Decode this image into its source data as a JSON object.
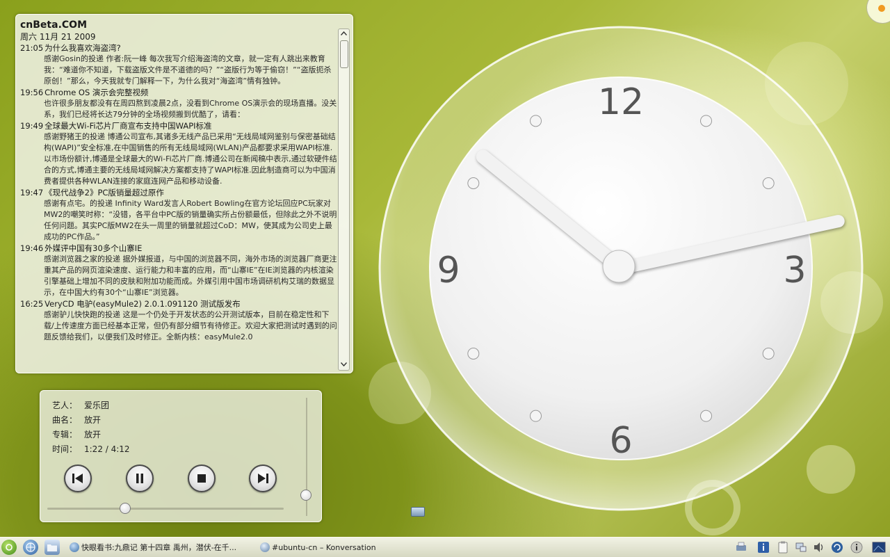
{
  "news_widget": {
    "title": "cnBeta.COM",
    "date": "周六 11月 21 2009",
    "items": [
      {
        "time": "21:05",
        "headline": "为什么我喜欢海盗湾?",
        "body": "感谢Gosin的投递 作者:阮一峰 每次我写介绍海盗湾的文章，就一定有人跳出来教育我：“难道你不知道，下载盗版文件是不道德的吗？”“盗版行为等于偷窃！”“盗版扼杀原创！”那么，今天我就专门解释一下，为什么我对“海盗湾”情有独钟。"
      },
      {
        "time": "19:56",
        "headline": "Chrome OS 演示会完整视频",
        "body": "也许很多朋友都没有在周四熬到凌晨2点，没看到Chrome OS演示会的现场直播。没关系，我们已经将长达79分钟的全场视频搬到优酷了，请看："
      },
      {
        "time": "19:49",
        "headline": "全球最大Wi-Fi芯片厂商宣布支持中国WAPI标准",
        "body": "感谢野猪王的投递 博通公司宣布,其诸多无线产品已采用“无线局域网鉴别与保密基础结构(WAPI)”安全标准,在中国销售的所有无线局域网(WLAN)产品都要求采用WAPI标准. 以市场份额计,博通是全球最大的Wi-Fi芯片厂商.博通公司在新闻稿中表示,通过软硬件结合的方式,博通主要的无线局域网解决方案都支持了WAPI标准.因此制造商可以为中国消费者提供各种WLAN连接的家庭连网产品和移动设备."
      },
      {
        "time": "19:47",
        "headline": "《现代战争2》PC版销量超过原作",
        "body": "感谢有点宅。的投递 Infinity Ward发言人Robert Bowling在官方论坛回应PC玩家对MW2的嘲笑时称：“没错，各平台中PC版的销量确实所占份额最低，但除此之外不说明任何问题。其实PC版MW2在头一周里的销量就超过CoD：MW，使其成为公司史上最成功的PC作品。”"
      },
      {
        "time": "19:46",
        "headline": "外媒评中国有30多个山寨IE",
        "body": "感谢浏览器之家的投递 据外媒报道，与中国的浏览器不同，海外市场的浏览器厂商更注重其产品的网页渲染速度、运行能力和丰富的应用，而“山寨IE”在IE浏览器的内核渲染引擎基础上增加不同的皮肤和附加功能而成。外媒引用中国市场调研机构艾瑞的数据显示，在中国大约有30个“山寨IE”浏览器。"
      },
      {
        "time": "16:25",
        "headline": "VeryCD 电驴(easyMule2) 2.0.1.091120 测试版发布",
        "body": "感谢驴儿快快跑的投递 这是一个仍处于开发状态的公开测试版本，目前在稳定性和下载/上传速度方面已经基本正常，但仍有部分细节有待修正。欢迎大家把测试时遇到的问题反馈给我们，以便我们及时修正。全新内核：easyMule2.0"
      }
    ],
    "scroll_up_icon": "arrow-up-icon",
    "scroll_down_icon": "arrow-down-icon"
  },
  "player": {
    "artist_label": "艺人：",
    "artist": "爱乐团",
    "title_label": "曲名：",
    "title": "放开",
    "album_label": "专辑：",
    "album": "放开",
    "time_label": "时间：",
    "time": "1:22 / 4:12",
    "position_fraction": 0.33,
    "volume_fraction": 1.0
  },
  "clock": {
    "numerals": [
      "12",
      "3",
      "6",
      "9"
    ],
    "hour": 11,
    "minute": 51.5,
    "face_color": "#f2f2f2"
  },
  "taskbar": {
    "tasks": [
      {
        "label": "快眼看书:九鼎记 第十四章 禹州，潜伏-在千..."
      },
      {
        "label": "#ubuntu-cn – Konversation"
      }
    ]
  }
}
